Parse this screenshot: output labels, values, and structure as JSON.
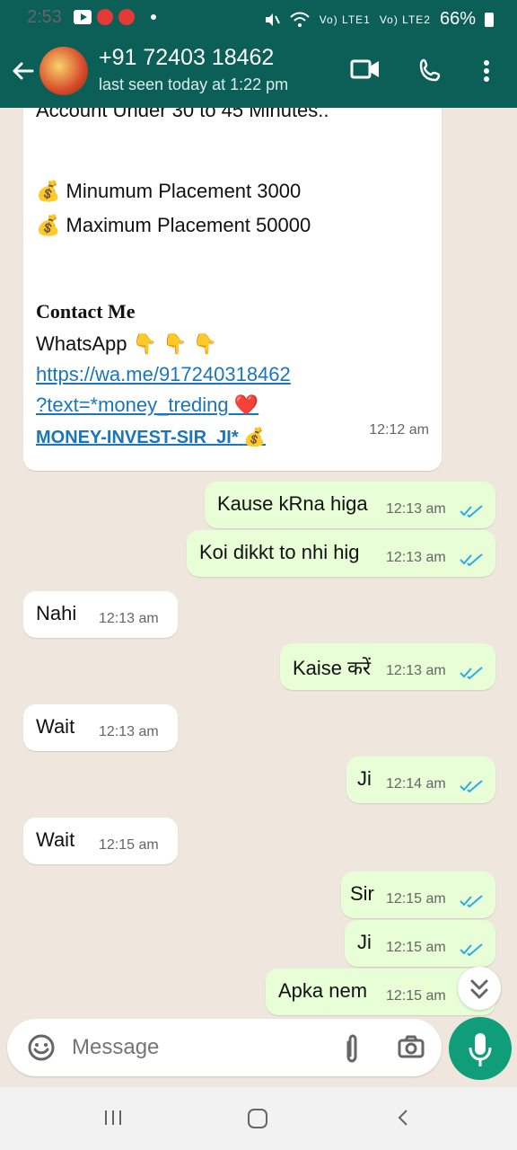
{
  "status_bar": {
    "time": "2:53",
    "network_label_1": "Vo) LTE1",
    "network_label_2": "Vo) LTE2",
    "battery": "66%"
  },
  "header": {
    "contact_title": "+91 72403 18462",
    "last_seen": "last seen today at 1:22 pm"
  },
  "messages": {
    "incoming_promo": {
      "cropped_top": "Account Under 30 to 45 Minutes..",
      "min_text": "Minumum Placement 3000",
      "max_text": "Maximum Placement 50000",
      "contact_heading": "Contact Me",
      "whatsapp_line": "WhatsApp",
      "link_line_1": "https://wa.me/917240318462",
      "link_line_2": "?text=*money_treding",
      "bold_link": "MONEY-INVEST-SIR_JI*",
      "time": "12:12 am",
      "emoji_money_bag": "💰",
      "emoji_down": "👇",
      "emoji_heart": "❤️"
    },
    "out_1": {
      "text": "Kause kRna higa",
      "time": "12:13 am"
    },
    "out_2": {
      "text": "Koi dikkt to nhi hig",
      "time": "12:13 am"
    },
    "in_1": {
      "text": "Nahi",
      "time": "12:13 am"
    },
    "out_3": {
      "text": "Kaise करें",
      "time": "12:13 am"
    },
    "in_2": {
      "text": "Wait",
      "time": "12:13 am"
    },
    "out_4": {
      "text": "Ji",
      "time": "12:14 am"
    },
    "in_3": {
      "text": "Wait",
      "time": "12:15 am"
    },
    "out_5": {
      "text": "Sir",
      "time": "12:15 am"
    },
    "out_6": {
      "text": "Ji",
      "time": "12:15 am"
    },
    "out_7": {
      "text": "Apka nem",
      "time": "12:15 am"
    }
  },
  "composer": {
    "placeholder": "Message"
  },
  "colors": {
    "header_bg": "#0b5f57",
    "incoming_bg": "#ffffff",
    "outgoing_bg": "#e7fed6",
    "link": "#1b75bc",
    "tick_blue": "#2fa9e6",
    "mic_bg": "#0f9d7a"
  },
  "icons": {
    "back": "back-arrow-icon",
    "video": "video-call-icon",
    "call": "phone-call-icon",
    "more": "more-vert-icon",
    "emoji": "emoji-icon",
    "attach": "paperclip-icon",
    "camera": "camera-icon",
    "mic": "mic-icon",
    "scroll": "double-chevron-down-icon",
    "nav_recent": "recent-apps-icon",
    "nav_home": "home-icon",
    "nav_back": "nav-back-icon"
  }
}
